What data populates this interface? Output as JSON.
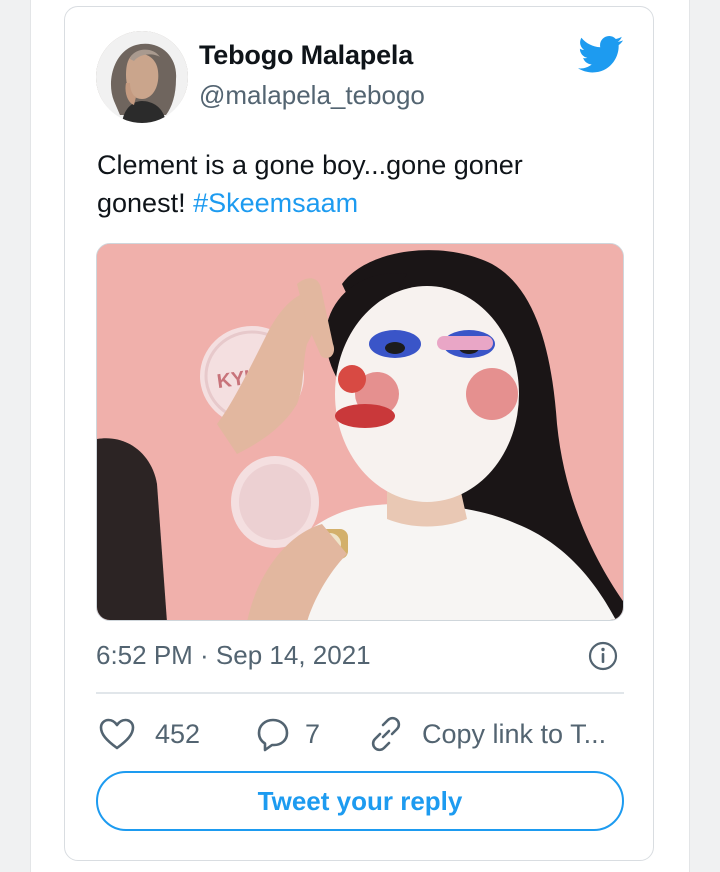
{
  "tweet": {
    "author": {
      "name": "Tebogo Malapela",
      "handle": "@malapela_tebogo"
    },
    "text_main": "Clement is a gone boy...gone goner gonest! ",
    "hashtag": "#Skeemsaam",
    "media": {
      "description": "Image: woman with clown-style makeup applying eyelashes while holding a round compact mirror",
      "printed_text": "KYLIE"
    },
    "timestamp": "6:52 PM · Sep 14, 2021",
    "actions": {
      "likes": "452",
      "replies": "7",
      "copy_link": "Copy link to T..."
    },
    "reply_button": "Tweet your reply"
  },
  "colors": {
    "accent": "#1d9bf0",
    "secondary_text": "#536471",
    "primary_text": "#0f1419",
    "card_border": "#d9dde1"
  },
  "icons": [
    "twitter-bird-icon",
    "info-icon",
    "heart-icon",
    "comment-icon",
    "link-icon"
  ]
}
